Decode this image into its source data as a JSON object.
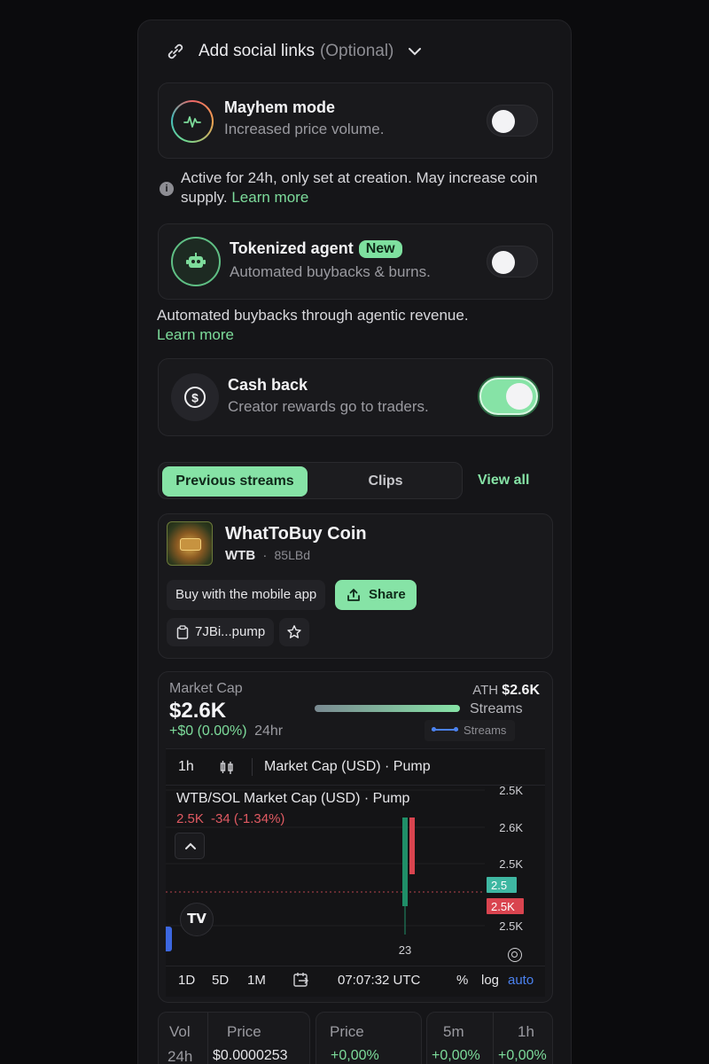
{
  "social": {
    "label": "Add social links",
    "optional": "(Optional)"
  },
  "mayhem": {
    "title": "Mayhem mode",
    "subtitle": "Increased price volume.",
    "enabled": false,
    "note": "Active for 24h, only set at creation. May increase coin supply.",
    "learn_more": "Learn more"
  },
  "agent": {
    "title": "Tokenized agent",
    "badge": "New",
    "subtitle": "Automated buybacks & burns.",
    "enabled": false,
    "note": "Automated buybacks through agentic revenue.",
    "learn_more": "Learn more"
  },
  "cashback": {
    "title": "Cash back",
    "subtitle": "Creator rewards go to traders.",
    "enabled": true
  },
  "tabs": {
    "previous": "Previous streams",
    "clips": "Clips",
    "view_all": "View all"
  },
  "coin": {
    "name": "WhatToBuy Coin",
    "ticker": "WTB",
    "dot": "·",
    "creator": "85LBd",
    "buy_mobile": "Buy with the mobile app",
    "share": "Share",
    "address": "7JBi...pump"
  },
  "market": {
    "label": "Market Cap",
    "value": "$2.6K",
    "change": "+$0 (0.00%)",
    "period": "24hr",
    "ath_label": "ATH",
    "ath_value": "$2.6K",
    "ath_progress": 1.0,
    "streams": "Streams",
    "legend_streams": "Streams"
  },
  "chart_toolbar": {
    "interval": "1h",
    "title": "Market Cap (USD) · Pump"
  },
  "chart_legend": {
    "pair": "WTB/SOL Market Cap (USD) · Pump",
    "last": "2.5K",
    "delta": "-34 (-1.34%)"
  },
  "chart_data": {
    "type": "candlestick",
    "y_ticks": [
      "2.5K",
      "2.6K",
      "2.5K",
      "2.5K"
    ],
    "x_ticks": [
      "23"
    ],
    "price_tags": [
      {
        "label": "2.5",
        "color": "#3fb7a2"
      },
      {
        "label": "2.5K",
        "color": "#d9444f"
      }
    ],
    "candles": [
      {
        "direction": "up",
        "color": "#1f8f68"
      },
      {
        "direction": "down",
        "color": "#d9444f"
      }
    ]
  },
  "chart_footer": {
    "ranges": [
      "1D",
      "5D",
      "1M"
    ],
    "time": "07:07:32 UTC",
    "percent": "%",
    "log": "log",
    "auto": "auto"
  },
  "stats": {
    "vol_label": "Vol",
    "vol_period": "24h",
    "price_label": "Price",
    "price_value": "$0.0000253",
    "price2_label": "Price",
    "price2_value": "+0,00%",
    "m5_label": "5m",
    "m5_value": "+0,00%",
    "h1_label": "1h",
    "h1_value": "+0,00%"
  },
  "colors": {
    "accent": "#86e3a6",
    "negative": "#d9444f",
    "muted": "#9a9aa0"
  }
}
